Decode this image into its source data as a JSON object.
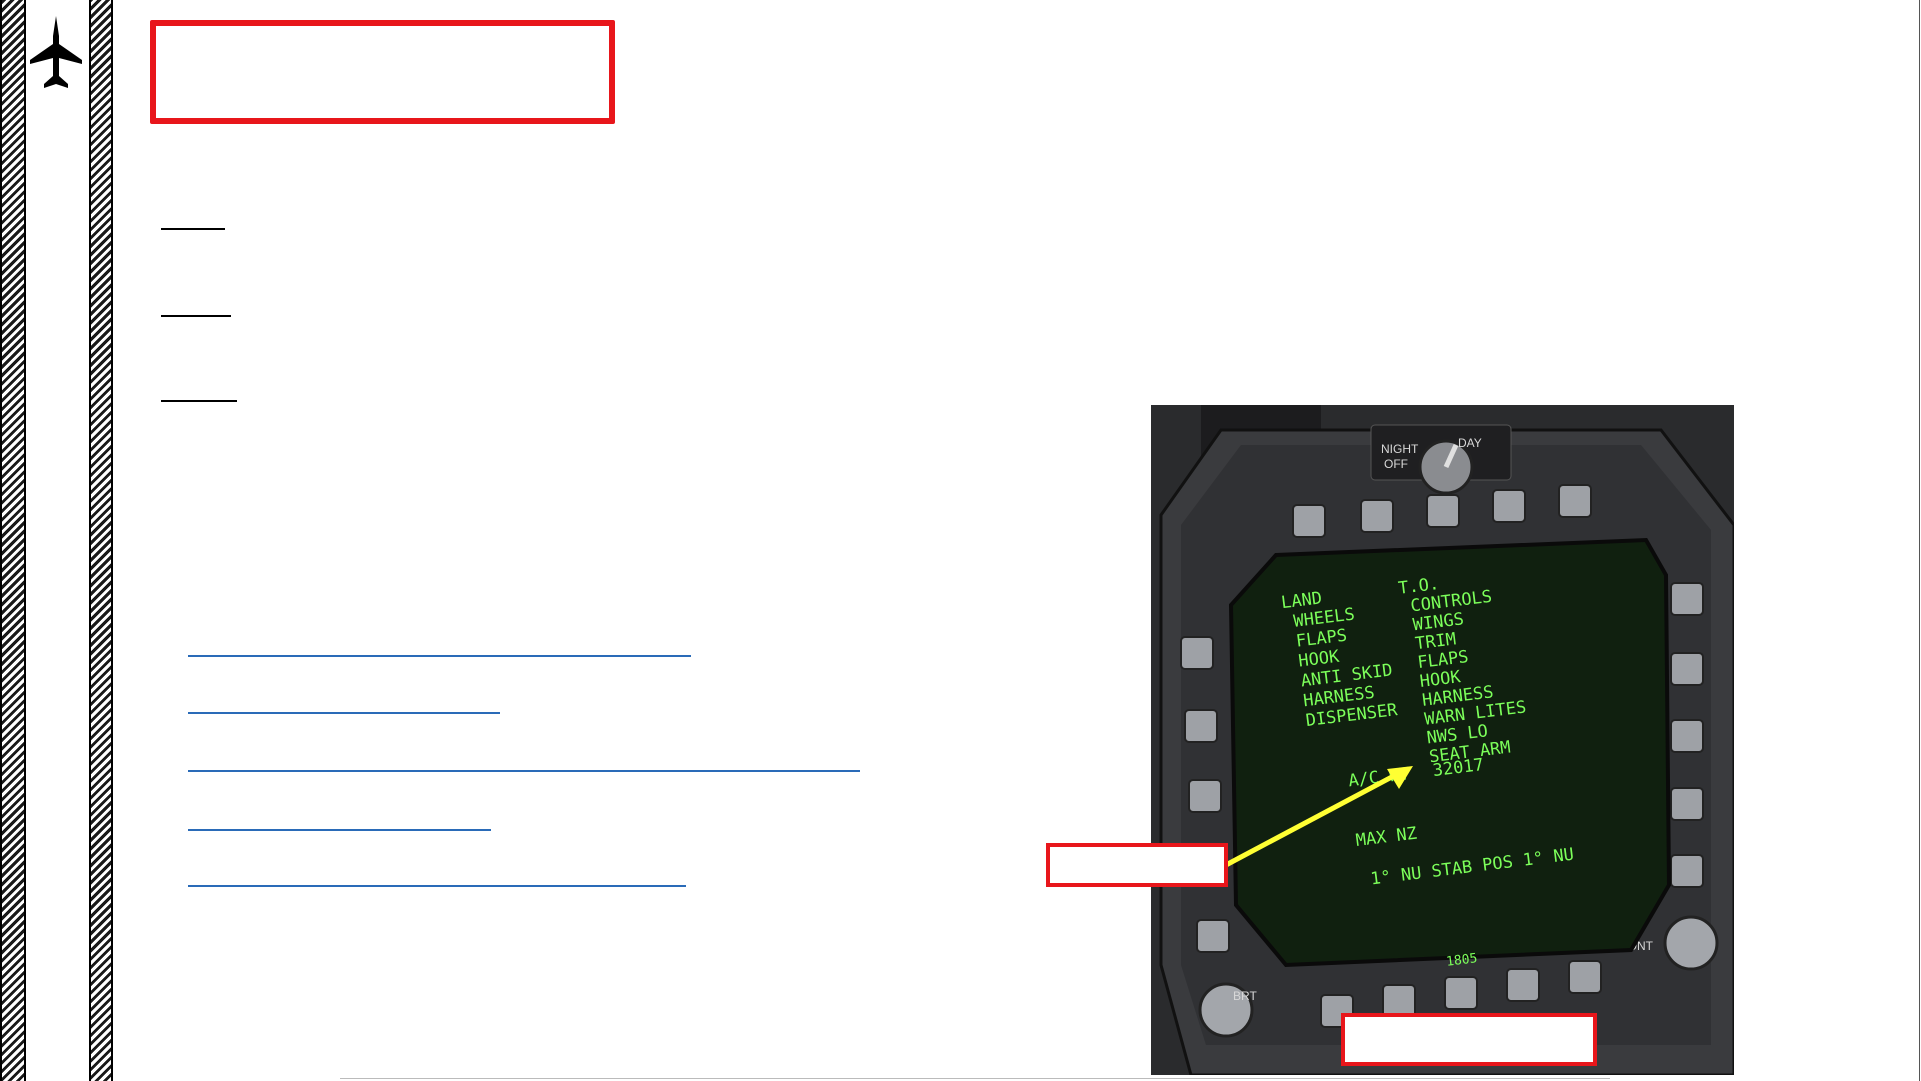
{
  "sidebar": {
    "icon": "fighter-jet-icon"
  },
  "title_box": {
    "text": ""
  },
  "headings": [
    "",
    "",
    ""
  ],
  "links": [
    "",
    "",
    "",
    "",
    ""
  ],
  "mfd": {
    "switch_labels": {
      "night": "NIGHT",
      "off": "OFF",
      "day": "DAY"
    },
    "left_column": [
      "LAND",
      "WHEELS",
      "FLAPS",
      "HOOK",
      "ANTI SKID",
      "HARNESS",
      "DISPENSER"
    ],
    "right_column": [
      "T.O.",
      "CONTROLS",
      "WINGS",
      "TRIM",
      "FLAPS",
      "HOOK",
      "HARNESS",
      "WARN LITES",
      "NWS LO",
      "SEAT ARM"
    ],
    "weight_label": "A/C WT",
    "weight_value": "32017",
    "max_nz_label": "MAX NZ",
    "stab_line": "1° NU STAB POS 1° NU",
    "time": "1805",
    "brt_label": "BRT",
    "cont_label": "CONT"
  },
  "callouts": {
    "weight": "",
    "bottom": ""
  },
  "colors": {
    "accent_red": "#e8161b",
    "link_blue": "#2a6bb8",
    "screen_green": "#7cff5a",
    "arrow_yellow": "#ffff33"
  }
}
